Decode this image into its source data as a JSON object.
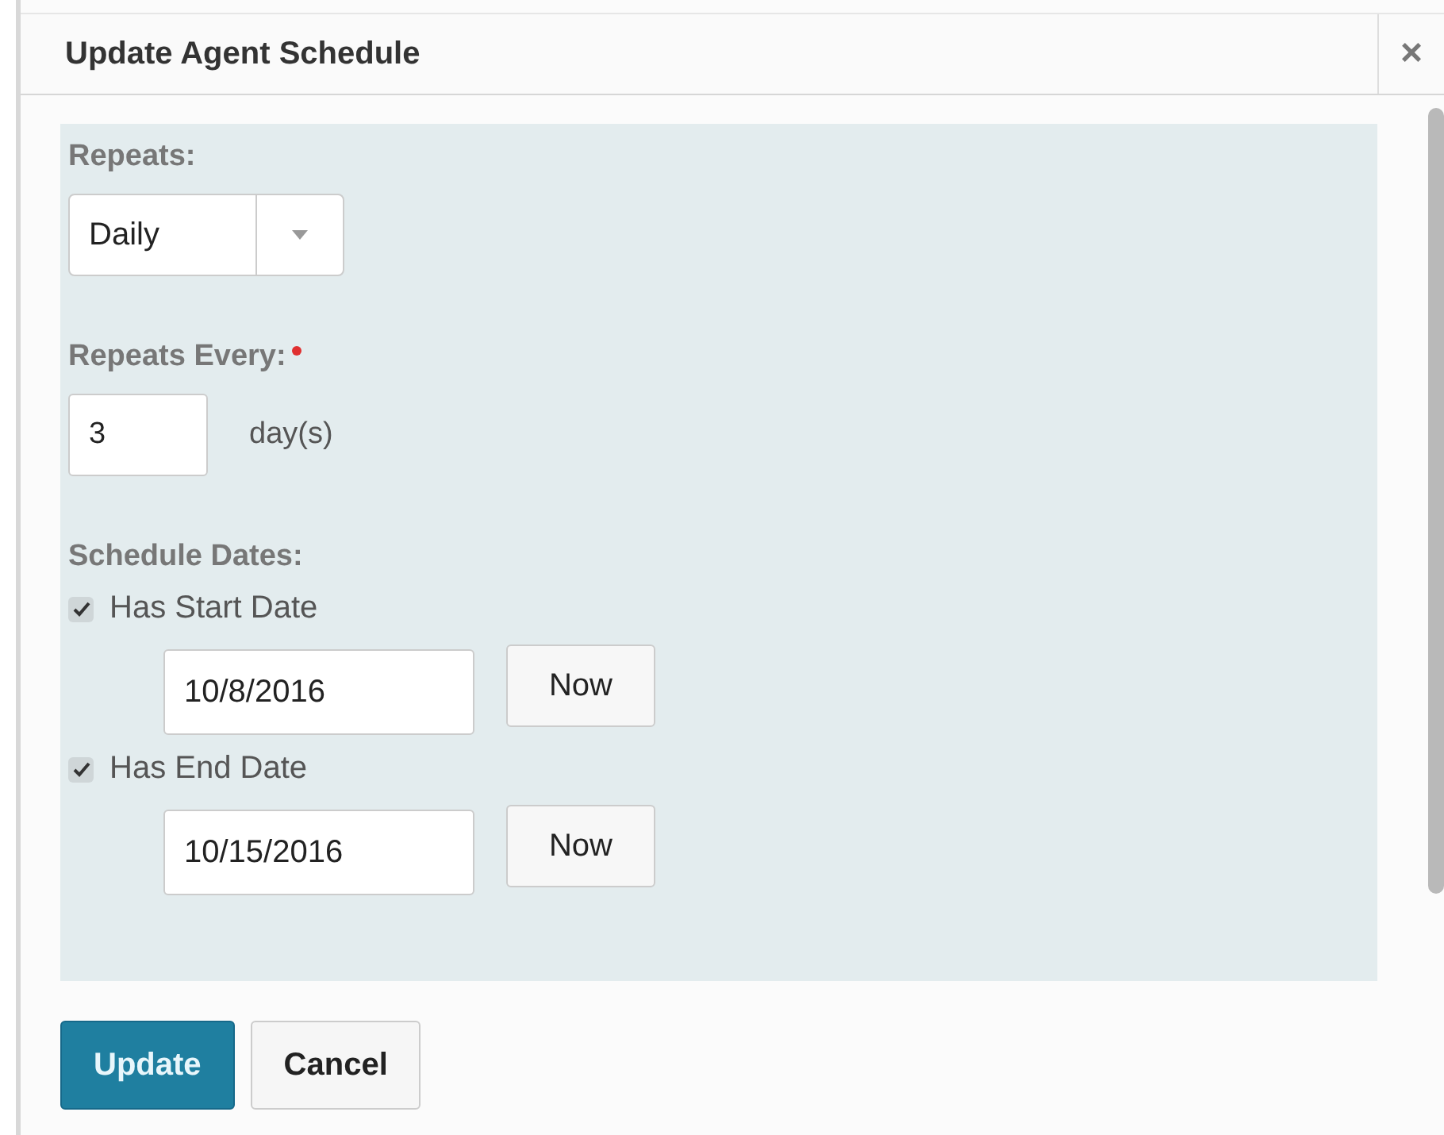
{
  "dialog": {
    "title": "Update Agent Schedule",
    "close": "×"
  },
  "repeats": {
    "label": "Repeats:",
    "value": "Daily"
  },
  "repeats_every": {
    "label": "Repeats Every:",
    "required": true,
    "value": "3",
    "unit": "day(s)"
  },
  "schedule_dates": {
    "label": "Schedule Dates:",
    "items": [
      {
        "label": "Has Start Date",
        "checked": true,
        "value": "10/8/2016",
        "button": "Now"
      },
      {
        "label": "Has End Date",
        "checked": true,
        "value": "10/15/2016",
        "button": "Now"
      }
    ]
  },
  "buttons": [
    {
      "label": "Update",
      "kind": "primary"
    },
    {
      "label": "Cancel",
      "kind": "default"
    }
  ]
}
